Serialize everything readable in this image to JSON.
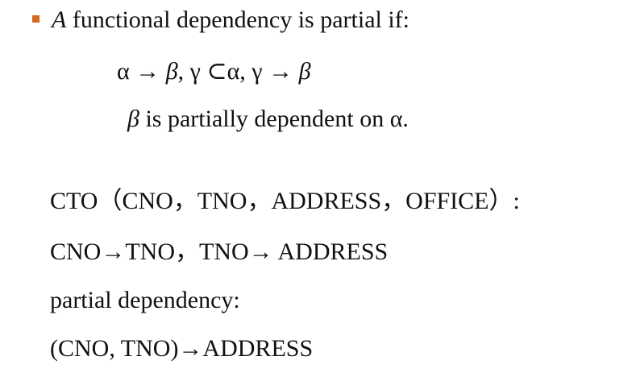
{
  "bullet": {
    "color": "#d2691e",
    "icon": "square-bullet"
  },
  "heading": {
    "italic_letter": "A",
    "rest": " functional dependency is partial if:"
  },
  "formula": {
    "alpha1": "α",
    "arrow1": " → ",
    "beta1": "β",
    "comma1": ", ",
    "gamma1": "γ",
    "subset": " ⊂",
    "alpha2": "α",
    "comma2": ", ",
    "gamma2": "γ",
    "arrow2": " → ",
    "beta2": "β"
  },
  "statement": {
    "beta": "β",
    "rest": " is partially dependent on α."
  },
  "example": {
    "relation": "CTO（CNO，TNO，ADDRESS，OFFICE）:",
    "dependencies": "CNO→TNO，TNO→ ADDRESS",
    "label": "partial dependency:",
    "partial": "(CNO, TNO)→ADDRESS"
  }
}
